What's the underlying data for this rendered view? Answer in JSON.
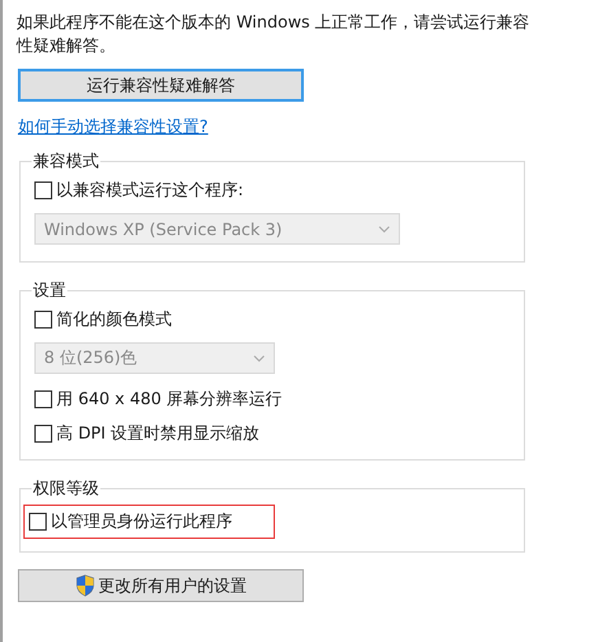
{
  "intro": "如果此程序不能在这个版本的 Windows 上正常工作，请尝试运行兼容性疑难解答。",
  "troubleshoot_button": {
    "label": "运行兼容性疑难解答",
    "focused": true
  },
  "help_link": "如何手动选择兼容性设置?",
  "groups": [
    {
      "title": "兼容模式",
      "items": [
        {
          "kind": "checkbox",
          "label": "以兼容模式运行这个程序:",
          "checked": false,
          "highlighted": false
        },
        {
          "kind": "dropdown",
          "value": "Windows XP (Service Pack 3)",
          "disabled": true,
          "wide": true
        }
      ]
    },
    {
      "title": "设置",
      "items": [
        {
          "kind": "checkbox",
          "label": "简化的颜色模式",
          "checked": false,
          "highlighted": false
        },
        {
          "kind": "dropdown",
          "value": "8 位(256)色",
          "disabled": true,
          "wide": false
        },
        {
          "kind": "checkbox",
          "label": "用 640 x 480 屏幕分辨率运行",
          "checked": false,
          "highlighted": false
        },
        {
          "kind": "checkbox",
          "label": "高 DPI 设置时禁用显示缩放",
          "checked": false,
          "highlighted": false
        }
      ]
    },
    {
      "title": "权限等级",
      "items": [
        {
          "kind": "checkbox",
          "label": "以管理员身份运行此程序",
          "checked": false,
          "highlighted": true
        }
      ]
    }
  ],
  "all_users_button": {
    "label": "更改所有用户的设置"
  }
}
